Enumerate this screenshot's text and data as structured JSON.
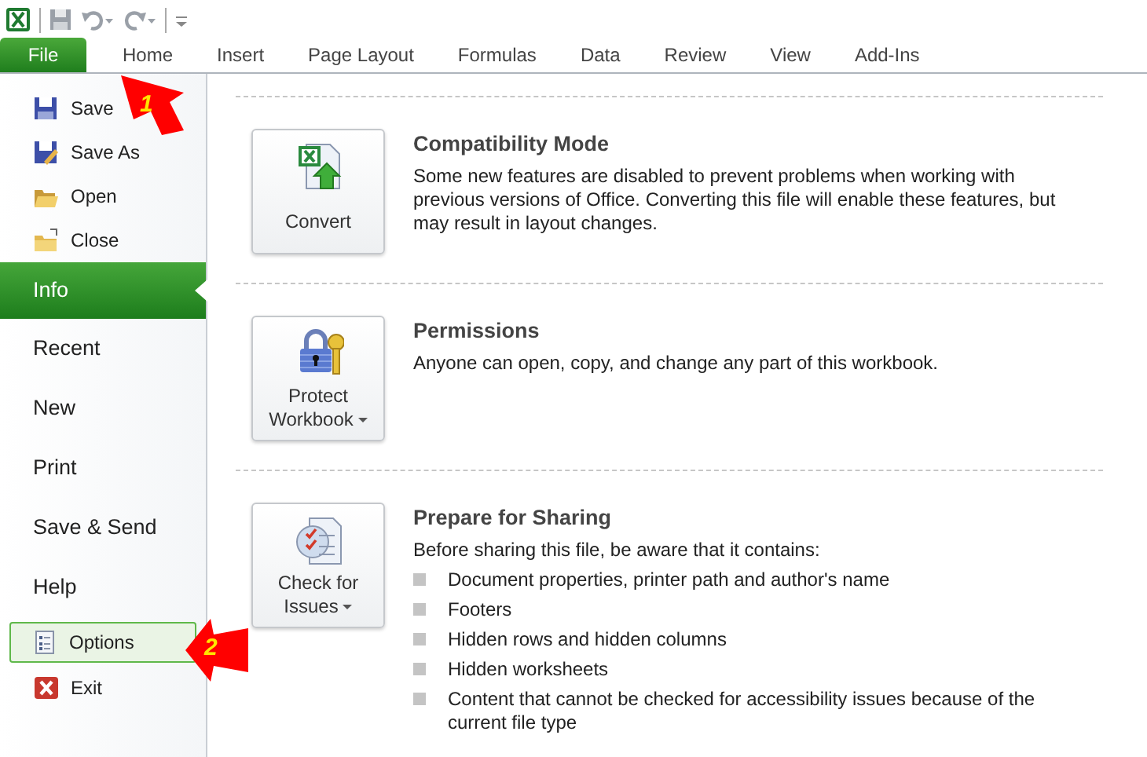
{
  "ribbon_tabs": [
    {
      "label": "File",
      "selected": true
    },
    {
      "label": "Home",
      "selected": false
    },
    {
      "label": "Insert",
      "selected": false
    },
    {
      "label": "Page Layout",
      "selected": false
    },
    {
      "label": "Formulas",
      "selected": false
    },
    {
      "label": "Data",
      "selected": false
    },
    {
      "label": "Review",
      "selected": false
    },
    {
      "label": "View",
      "selected": false
    },
    {
      "label": "Add-Ins",
      "selected": false
    }
  ],
  "sidebar": {
    "items": [
      {
        "label": "Save",
        "kind": "command",
        "selected": false,
        "highlighted": false
      },
      {
        "label": "Save As",
        "kind": "command",
        "selected": false,
        "highlighted": false
      },
      {
        "label": "Open",
        "kind": "command",
        "selected": false,
        "highlighted": false
      },
      {
        "label": "Close",
        "kind": "command",
        "selected": false,
        "highlighted": false
      },
      {
        "label": "Info",
        "kind": "tab",
        "selected": true,
        "highlighted": false
      },
      {
        "label": "Recent",
        "kind": "tab",
        "selected": false,
        "highlighted": false
      },
      {
        "label": "New",
        "kind": "tab",
        "selected": false,
        "highlighted": false
      },
      {
        "label": "Print",
        "kind": "tab",
        "selected": false,
        "highlighted": false
      },
      {
        "label": "Save & Send",
        "kind": "tab",
        "selected": false,
        "highlighted": false
      },
      {
        "label": "Help",
        "kind": "tab",
        "selected": false,
        "highlighted": false
      },
      {
        "label": "Options",
        "kind": "command",
        "selected": false,
        "highlighted": true
      },
      {
        "label": "Exit",
        "kind": "command",
        "selected": false,
        "highlighted": false
      }
    ]
  },
  "sections": [
    {
      "button_label": "Convert",
      "dropdown": false,
      "title": "Compatibility Mode",
      "text": "Some new features are disabled to prevent problems when working with previous versions of Office. Converting this file will enable these features, but may result in layout changes."
    },
    {
      "button_label": "Protect Workbook",
      "dropdown": true,
      "title": "Permissions",
      "text": "Anyone can open, copy, and change any part of this workbook."
    },
    {
      "button_label": "Check for Issues",
      "dropdown": true,
      "title": "Prepare for Sharing",
      "text": "Before sharing this file, be aware that it contains:",
      "bullets": [
        "Document properties, printer path and author's name",
        "Footers",
        "Hidden rows and hidden columns",
        "Hidden worksheets",
        "Content that cannot be checked for accessibility issues because of the current file type"
      ]
    }
  ],
  "callouts": [
    {
      "number": "1"
    },
    {
      "number": "2"
    }
  ]
}
